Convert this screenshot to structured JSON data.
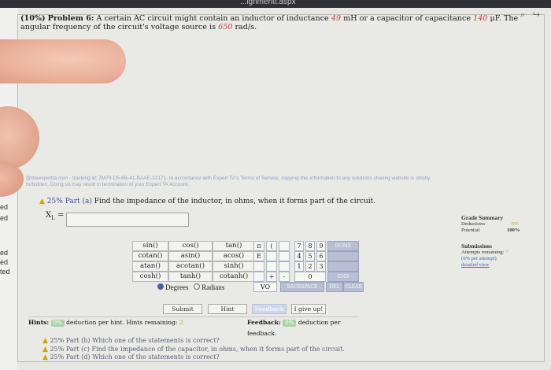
{
  "browser": {
    "url_fragment": "...ignmentt.aspx"
  },
  "icons": [
    "search-icon",
    "share-icon"
  ],
  "problem": {
    "weight": "(10%)",
    "label": "Problem 6:",
    "text_1": "A certain AC circuit might contain an inductor of inductance",
    "inductance": "49",
    "text_2": "mH or a capacitor of capacitance",
    "capacitance": "140",
    "text_3": "μF. The angular frequency of the",
    "text_4": "circuit's voltage source is",
    "omega": "650",
    "text_5": "rad/s."
  },
  "watermark": {
    "line1": "@theexpertta.com - tracking id: 7M79-D5-6B-41-BAAE-32171. In accordance with Expert TA's Terms of Service. copying this information to any solutions sharing website is strictly",
    "line2": "forbidden. Doing so may result in termination of your Expert TA Account."
  },
  "left_margin_labels": [
    "ed",
    "ed",
    "ed",
    "ed",
    "ted"
  ],
  "part_a": {
    "percent": "25%",
    "label": "Part (a)",
    "question": "Find the impedance of the inductor, in ohms, when it forms part of the circuit.",
    "variable": "X",
    "subscript": "L",
    "equals": "=",
    "input_value": ""
  },
  "keypad": {
    "functions": [
      [
        "sin()",
        "cos()",
        "tan()"
      ],
      [
        "cotan()",
        "asin()",
        "acos()"
      ],
      [
        "atan()",
        "acotan()",
        "sinh()"
      ],
      [
        "cosh()",
        "tanh()",
        "cotanh()"
      ]
    ],
    "symbols": [
      "π",
      "(",
      "E",
      "+",
      "-"
    ],
    "digits": [
      "7",
      "8",
      "9",
      "4",
      "5",
      "6",
      "1",
      "2",
      "3",
      "0"
    ],
    "extra": [
      "HOME",
      "END",
      "BACKSPACE",
      "DEL",
      "CLEAR"
    ],
    "vo": "VO",
    "degrees_label": "Degrees",
    "radians_label": "Radians",
    "angle_mode": "Degrees"
  },
  "actions": {
    "submit": "Submit",
    "hint": "Hint",
    "feedback": "Feedback",
    "give_up": "I give up!"
  },
  "hints": {
    "label": "Hints:",
    "pct": "0%",
    "text": "deduction per hint. Hints remaining:",
    "remaining": "2"
  },
  "feedback": {
    "label": "Feedback:",
    "pct": "0%",
    "text": "deduction per feedback."
  },
  "sub_parts": [
    {
      "pct": "25%",
      "label": "Part (b)",
      "text": "Which one of the statements is correct?"
    },
    {
      "pct": "25%",
      "label": "Part (c)",
      "text": "Find the impedance of the capacitor, in ohms, when it forms part of the circuit."
    },
    {
      "pct": "25%",
      "label": "Part (d)",
      "text": "Which one of the statements is correct?"
    }
  ],
  "grade_summary": {
    "title": "Grade Summary",
    "deductions_label": "Deductions",
    "deductions_value": "0%",
    "potential_label": "Potential",
    "potential_value": "100%",
    "submissions_title": "Submissions",
    "attempts_label": "Attempts remaining:",
    "attempts_value": "7",
    "per_attempt": "(0% per attempt)",
    "detailed_view": "detailed view"
  }
}
